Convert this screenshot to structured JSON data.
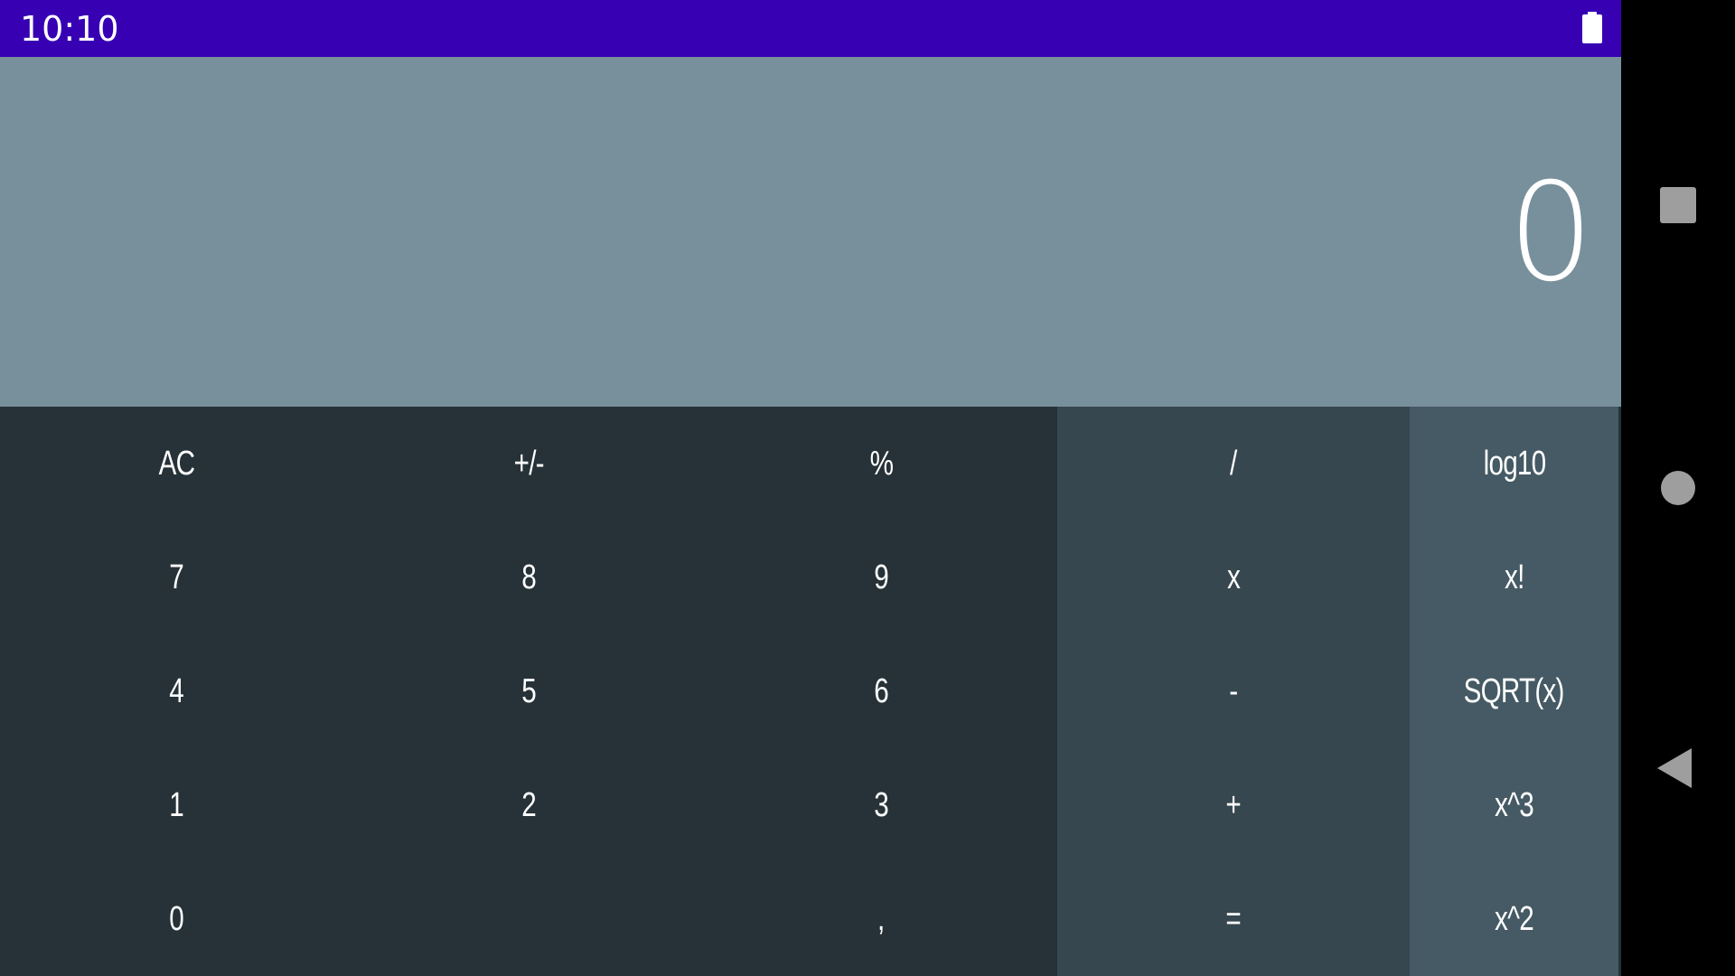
{
  "status_bar": {
    "time": "10:10",
    "battery_icon": "battery-full-icon",
    "background": "#3700b3"
  },
  "display": {
    "value": "0",
    "background": "#78909c"
  },
  "keypad": {
    "colors": {
      "numbers": "#263238",
      "operators": "#37474f",
      "scientific": "#455a64"
    },
    "numbers": {
      "ac": "AC",
      "plus_minus": "+/-",
      "percent": "%",
      "seven": "7",
      "eight": "8",
      "nine": "9",
      "four": "4",
      "five": "5",
      "six": "6",
      "one": "1",
      "two": "2",
      "three": "3",
      "zero": "0",
      "comma": ","
    },
    "operators": {
      "divide": "/",
      "multiply": "x",
      "minus": "-",
      "plus": "+",
      "equals": "="
    },
    "scientific": {
      "log10": "log10",
      "factorial": "x!",
      "sqrt": "SQRT(x)",
      "cube": "x^3",
      "square": "x^2"
    }
  },
  "nav_bar": {
    "recents_icon": "square-recents-icon",
    "home_icon": "circle-home-icon",
    "back_icon": "triangle-back-icon"
  }
}
